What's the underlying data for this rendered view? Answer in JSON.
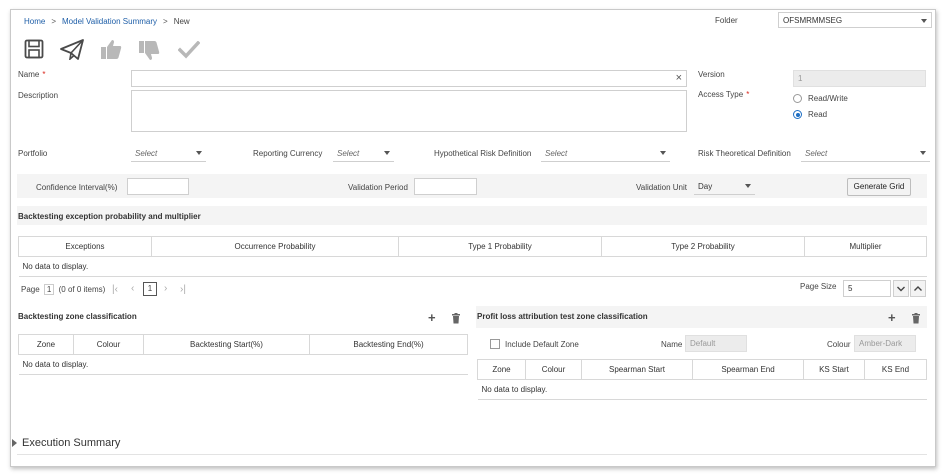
{
  "breadcrumb": {
    "home": "Home",
    "summary": "Model Validation Summary",
    "current": "New",
    "sep": ">"
  },
  "folder": {
    "label": "Folder",
    "value": "OFSMRMMSEG"
  },
  "toolbar": {
    "icons": [
      "save-icon",
      "send-icon",
      "thumbs-up-icon",
      "thumbs-down-icon",
      "check-icon"
    ]
  },
  "form": {
    "name_label": "Name",
    "name_value": "",
    "description_label": "Description",
    "version_label": "Version",
    "version_value": "1",
    "access_type_label": "Access Type",
    "access_options": [
      "Read/Write",
      "Read"
    ],
    "access_selected": "Read",
    "portfolio_label": "Portfolio",
    "portfolio_value": "Select",
    "reporting_currency_label": "Reporting Currency",
    "reporting_currency_value": "Select",
    "hypothetical_label": "Hypothetical Risk Definition",
    "hypothetical_value": "Select",
    "risk_theoretical_label": "Risk Theoretical Definition",
    "risk_theoretical_value": "Select",
    "confidence_label": "Confidence Interval(%)",
    "confidence_value": "",
    "validation_period_label": "Validation Period",
    "validation_period_value": "",
    "validation_unit_label": "Validation Unit",
    "validation_unit_value": "Day",
    "generate_grid_label": "Generate Grid"
  },
  "backtesting_exception": {
    "title": "Backtesting exception probability and multiplier",
    "columns": [
      "Exceptions",
      "Occurrence Probability",
      "Type 1 Probability",
      "Type 2 Probability",
      "Multiplier"
    ],
    "empty_text": "No data to display."
  },
  "pagination": {
    "page_label": "Page",
    "page_value": "1",
    "items_text": "(0 of 0 items)",
    "current_page": "1",
    "page_size_label": "Page Size",
    "page_size_value": "5"
  },
  "zone_classification": {
    "title": "Backtesting zone classification",
    "columns": [
      "Zone",
      "Colour",
      "Backtesting Start(%)",
      "Backtesting End(%)"
    ],
    "empty_text": "No data to display."
  },
  "pl_attribution": {
    "title": "Profit loss attribution test zone classification",
    "include_default_label": "Include Default Zone",
    "name_label": "Name",
    "name_value": "Default",
    "colour_label": "Colour",
    "colour_value": "Amber-Dark",
    "columns": [
      "Zone",
      "Colour",
      "Spearman Start",
      "Spearman End",
      "KS Start",
      "KS End"
    ],
    "empty_text": "No data to display."
  },
  "execution_summary": {
    "label": "Execution Summary"
  },
  "colors": {
    "link": "#1f5fa8",
    "required": "#d9261c",
    "radio_selected": "#1f6fc4",
    "icon_dark": "#4a4a4a",
    "icon_light": "#b8b8b8"
  }
}
